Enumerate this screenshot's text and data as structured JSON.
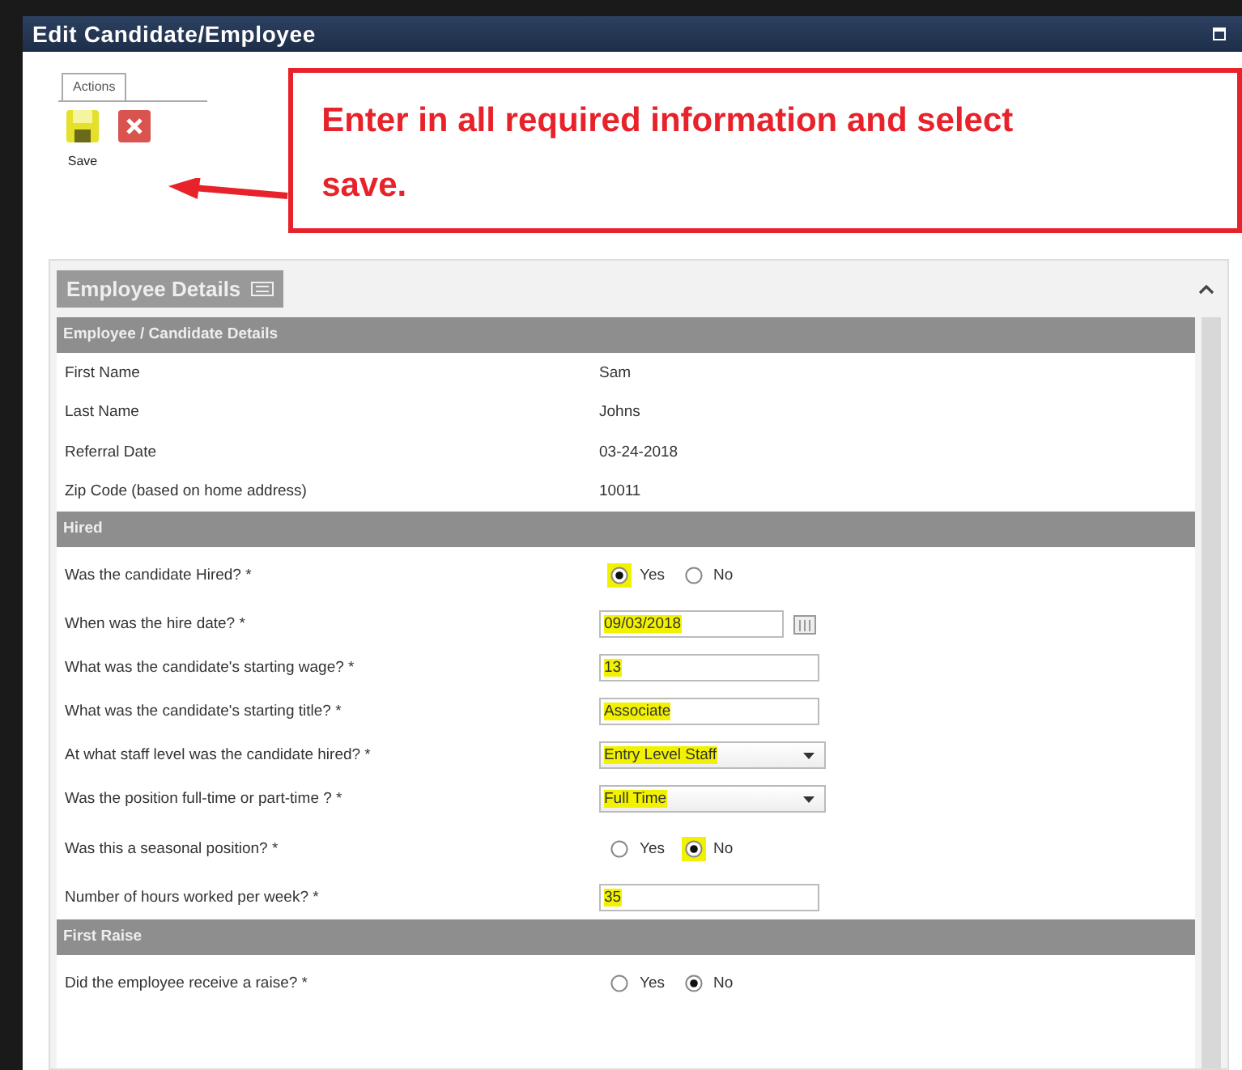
{
  "window": {
    "title": "Edit Candidate/Employee"
  },
  "toolbar": {
    "tab": "Actions",
    "buttons": [
      {
        "kind": "save",
        "label": "Save"
      },
      {
        "kind": "delete"
      }
    ]
  },
  "callout": {
    "text": "Enter in all required information and select save."
  },
  "panel": {
    "title": "Employee Details",
    "sections": [
      {
        "title": "Employee / Candidate Details",
        "rows": [
          {
            "kind": "static",
            "label": "First Name",
            "value": "Sam"
          },
          {
            "kind": "static",
            "label": "Last Name",
            "value": "Johns"
          },
          {
            "kind": "static",
            "label": "Referral Date",
            "value": "03-24-2018"
          },
          {
            "kind": "static",
            "label": "Zip Code (based on home address)",
            "value": "10011"
          }
        ]
      },
      {
        "title": "Hired",
        "rows": [
          {
            "kind": "radio",
            "label": "Was the candidate Hired? *",
            "options": [
              {
                "label": "Yes",
                "selected": true,
                "highlighted": true
              },
              {
                "label": "No",
                "selected": false,
                "highlighted": false
              }
            ]
          },
          {
            "kind": "date",
            "label": "When was the hire date? *",
            "value": "09/03/2018",
            "highlighted": true
          },
          {
            "kind": "text",
            "label": "What was the candidate's starting wage? *",
            "value": "13",
            "highlighted": true
          },
          {
            "kind": "text",
            "label": "What was the candidate's starting title? *",
            "value": "Associate",
            "highlighted": true
          },
          {
            "kind": "select",
            "label": "At what staff level was the candidate hired? *",
            "value": "Entry Level Staff",
            "highlighted": true
          },
          {
            "kind": "select",
            "label": "Was the position full-time or part-time ? *",
            "value": "Full Time",
            "highlighted": true
          },
          {
            "kind": "radio",
            "label": "Was this a seasonal position? *",
            "options": [
              {
                "label": "Yes",
                "selected": false,
                "highlighted": false
              },
              {
                "label": "No",
                "selected": true,
                "highlighted": true
              }
            ]
          },
          {
            "kind": "text",
            "label": "Number of hours worked per week? *",
            "value": "35",
            "highlighted": true
          }
        ]
      },
      {
        "title": "First Raise",
        "rows": [
          {
            "kind": "radio",
            "label": "Did the employee receive a raise? *",
            "options": [
              {
                "label": "Yes",
                "selected": false,
                "highlighted": false
              },
              {
                "label": "No",
                "selected": true,
                "highlighted": false
              }
            ]
          }
        ]
      }
    ]
  }
}
